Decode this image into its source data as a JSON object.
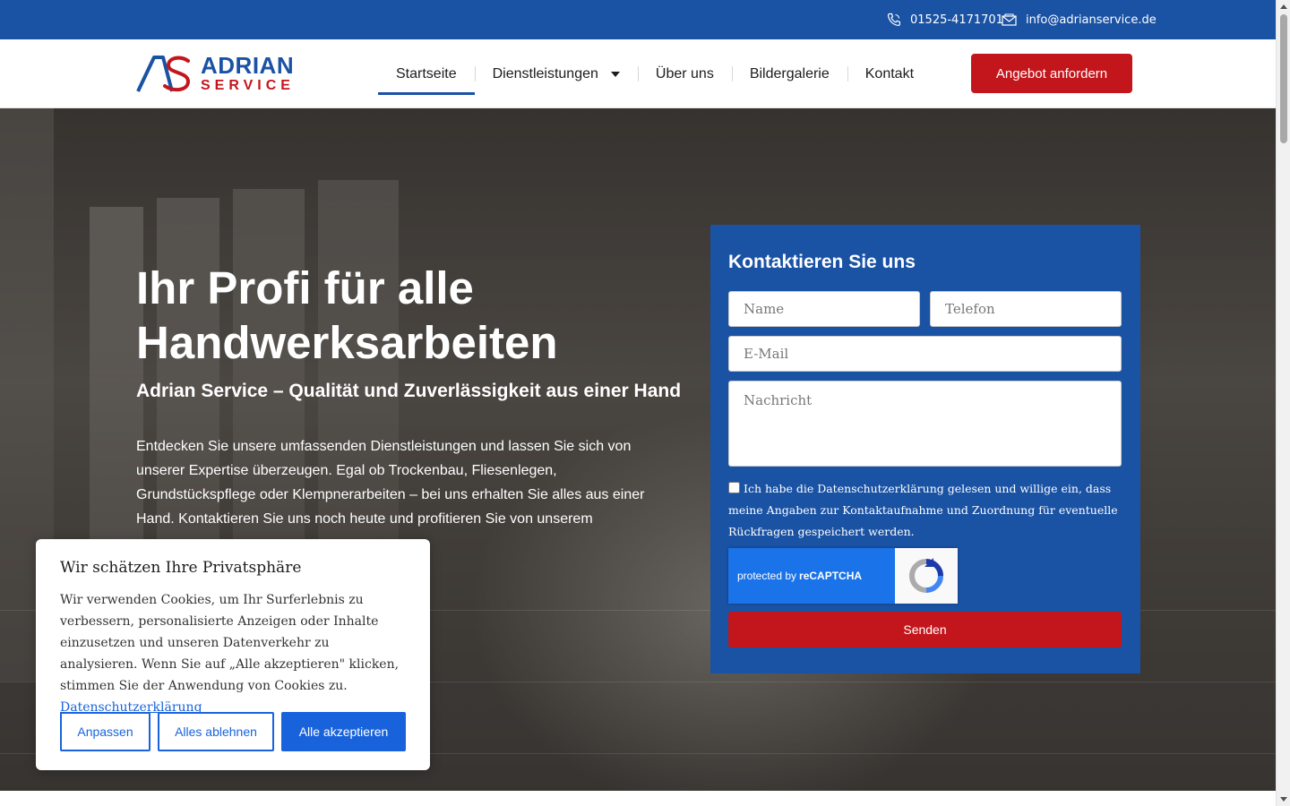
{
  "topbar": {
    "phone": "01525-4171701",
    "email": "info@adrianservice.de",
    "phone_icon": "phone-icon",
    "email_icon": "envelope-icon"
  },
  "logo": {
    "line1": "ADRIAN",
    "line2": "SERVICE"
  },
  "nav": {
    "items": [
      {
        "label": "Startseite"
      },
      {
        "label": "Dienstleistungen"
      },
      {
        "label": "Über uns"
      },
      {
        "label": "Bildergalerie"
      },
      {
        "label": "Kontakt"
      }
    ],
    "cta_label": "Angebot anfordern"
  },
  "hero": {
    "title": "Ihr Profi für alle Handwerksarbeiten",
    "subtitle": "Adrian Service – Qualität und Zuverlässigkeit aus einer Hand",
    "text": "Entdecken Sie unsere umfassenden Dienstleistungen und lassen Sie sich von unserer Expertise überzeugen. Egal ob Trockenbau, Fliesenlegen, Grundstückspflege oder Klempnerarbeiten – bei uns erhalten Sie alles aus einer Hand. Kontaktieren Sie uns noch heute und profitieren Sie von unserem"
  },
  "form": {
    "title": "Kontaktieren Sie uns",
    "name_placeholder": "Name",
    "phone_placeholder": "Telefon",
    "email_placeholder": "E-Mail",
    "message_placeholder": "Nachricht",
    "consent_text": "Ich habe die Datenschutzerklärung gelesen und willige ein, dass meine Angaben zur Kontaktaufnahme und Zuordnung für eventuelle Rückfragen gespeichert werden.",
    "recaptcha_prefix": "protected by",
    "recaptcha_brand": "reCAPTCHA",
    "submit_label": "Senden"
  },
  "cookie": {
    "title": "Wir schätzen Ihre Privatsphäre",
    "text": "Wir verwenden Cookies, um Ihr Surferlebnis zu verbessern, personalisierte Anzeigen oder Inhalte einzusetzen und unseren Datenverkehr zu analysieren. Wenn Sie auf „Alle akzeptieren\" klicken, stimmen Sie der Anwendung von Cookies zu.",
    "link_label": "Datenschutzerklärung",
    "btn_customize": "Anpassen",
    "btn_reject": "Alles ablehnen",
    "btn_accept": "Alle akzeptieren"
  },
  "colors": {
    "brand_blue": "#1a52a4",
    "brand_red": "#c3161c",
    "cookie_blue": "#1863dc"
  }
}
